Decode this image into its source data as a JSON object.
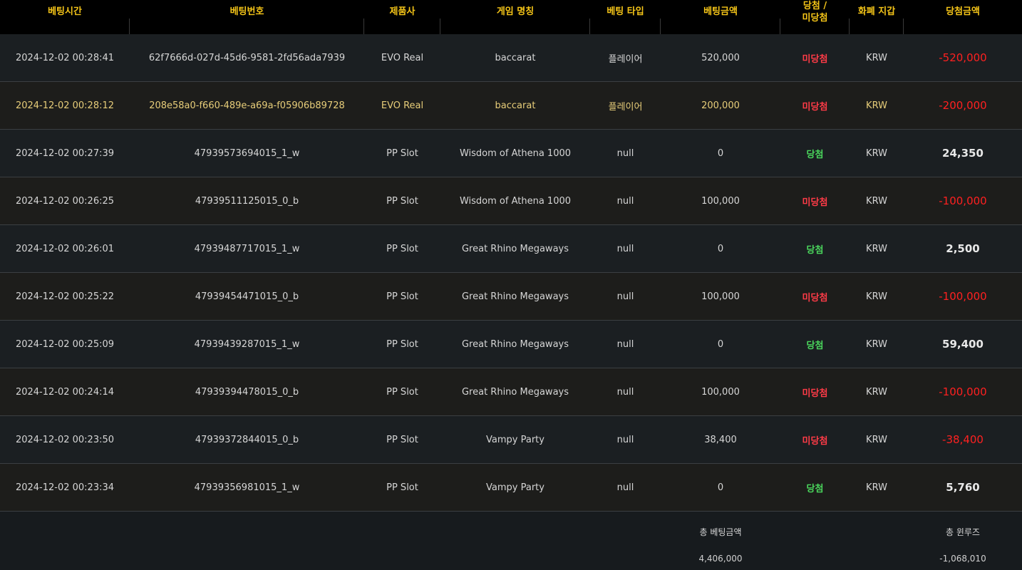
{
  "headers": [
    "베팅시간",
    "베팅번호",
    "제품사",
    "게임 명칭",
    "베팅 타입",
    "베팅금액",
    "당첨 /",
    "화폐 지갑",
    "당첨금액"
  ],
  "headers_line2": {
    "result": "미당첨"
  },
  "rows": [
    {
      "time": "2024-12-02 00:28:41",
      "id": "62f7666d-027d-45d6-9581-2fd56ada7939",
      "provider": "EVO Real",
      "game": "baccarat",
      "type": "플레이어",
      "bet": "520,000",
      "result": "미당첨",
      "currency": "KRW",
      "win": "-520,000",
      "status": "loss",
      "highlight": false
    },
    {
      "time": "2024-12-02 00:28:12",
      "id": "208e58a0-f660-489e-a69a-f05906b89728",
      "provider": "EVO Real",
      "game": "baccarat",
      "type": "플레이어",
      "bet": "200,000",
      "result": "미당첨",
      "currency": "KRW",
      "win": "-200,000",
      "status": "loss",
      "highlight": true
    },
    {
      "time": "2024-12-02 00:27:39",
      "id": "47939573694015_1_w",
      "provider": "PP Slot",
      "game": "Wisdom of Athena 1000",
      "type": "null",
      "bet": "0",
      "result": "당첨",
      "currency": "KRW",
      "win": "24,350",
      "status": "win",
      "highlight": false
    },
    {
      "time": "2024-12-02 00:26:25",
      "id": "47939511125015_0_b",
      "provider": "PP Slot",
      "game": "Wisdom of Athena 1000",
      "type": "null",
      "bet": "100,000",
      "result": "미당첨",
      "currency": "KRW",
      "win": "-100,000",
      "status": "loss",
      "highlight": false
    },
    {
      "time": "2024-12-02 00:26:01",
      "id": "47939487717015_1_w",
      "provider": "PP Slot",
      "game": "Great Rhino Megaways",
      "type": "null",
      "bet": "0",
      "result": "당첨",
      "currency": "KRW",
      "win": "2,500",
      "status": "win",
      "highlight": false
    },
    {
      "time": "2024-12-02 00:25:22",
      "id": "47939454471015_0_b",
      "provider": "PP Slot",
      "game": "Great Rhino Megaways",
      "type": "null",
      "bet": "100,000",
      "result": "미당첨",
      "currency": "KRW",
      "win": "-100,000",
      "status": "loss",
      "highlight": false
    },
    {
      "time": "2024-12-02 00:25:09",
      "id": "47939439287015_1_w",
      "provider": "PP Slot",
      "game": "Great Rhino Megaways",
      "type": "null",
      "bet": "0",
      "result": "당첨",
      "currency": "KRW",
      "win": "59,400",
      "status": "win",
      "highlight": false
    },
    {
      "time": "2024-12-02 00:24:14",
      "id": "47939394478015_0_b",
      "provider": "PP Slot",
      "game": "Great Rhino Megaways",
      "type": "null",
      "bet": "100,000",
      "result": "미당첨",
      "currency": "KRW",
      "win": "-100,000",
      "status": "loss",
      "highlight": false
    },
    {
      "time": "2024-12-02 00:23:50",
      "id": "47939372844015_0_b",
      "provider": "PP Slot",
      "game": "Vampy Party",
      "type": "null",
      "bet": "38,400",
      "result": "미당첨",
      "currency": "KRW",
      "win": "-38,400",
      "status": "loss",
      "highlight": false
    },
    {
      "time": "2024-12-02 00:23:34",
      "id": "47939356981015_1_w",
      "provider": "PP Slot",
      "game": "Vampy Party",
      "type": "null",
      "bet": "0",
      "result": "당첨",
      "currency": "KRW",
      "win": "5,760",
      "status": "win",
      "highlight": false
    }
  ],
  "footer": {
    "total_bet_label": "총 베팅금액",
    "total_bet_value": "4,406,000",
    "total_winloss_label": "총 윈루즈",
    "total_winloss_value": "-1,068,010"
  },
  "colors": {
    "header_text": "#f5c518",
    "loss": "#ff3b47",
    "win": "#4ad65c",
    "negative_amount": "#ff2020",
    "highlight_row_text": "#e7cd79"
  }
}
